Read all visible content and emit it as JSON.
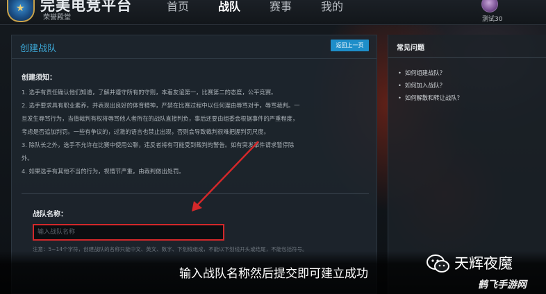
{
  "header": {
    "logo_title": "完美电竞平台",
    "logo_subtitle": "荣誉殿堂",
    "nav": [
      {
        "label": "首页",
        "active": false
      },
      {
        "label": "战队",
        "active": true
      },
      {
        "label": "赛事",
        "active": false
      },
      {
        "label": "我的",
        "active": false
      }
    ],
    "username": "测试30"
  },
  "main": {
    "title": "创建战队",
    "back_button": "返回上一页",
    "rules_heading": "创建须知：",
    "rules": [
      "1. 选手有责任确认他们知道，了解并遵守所有的守则，本着友谊第一，比赛第二的态度，公平竞赛。",
      "2. 选手要求具有职业素养，并表现出良好的体育精神，严禁在比赛过程中以任何理由辱骂对手，辱骂裁判。一",
      "旦发生辱骂行为，当值裁判有权将辱骂他人者所在的战队直接判负，事后还要由组委会根据事件的严重程度，",
      "考虑是否追加判罚。一些有争议的，过激的语言也禁止出现，否则会导致裁判很难把握判罚尺度。",
      "3. 除队长之外，选手不允许在比赛中使用公聊，违反者将有可能受到裁判的警告。如有突发事件请求暂停除",
      "外。",
      "4. 如果选手有其他不当的行为，视情节严重，由裁判做出处罚。"
    ],
    "name_label": "战队名称：",
    "name_input": {
      "value": "",
      "placeholder": "输入战队名称"
    },
    "note": "注意：5~14个字符，创建战队的名称只能中文、英文、数字、下划线组成，不能以下划线开头或结尾，不能包括符号。"
  },
  "faq": {
    "title": "常见问题",
    "items": [
      "如何组建战队？",
      "如何加入战队？",
      "如何解散和转让战队？"
    ]
  },
  "overlay": {
    "caption": "输入战队名称然后提交即可建立成功",
    "watermark_brand": "天辉夜魔",
    "watermark_site": "鹤飞手游网"
  },
  "colors": {
    "accent_blue": "#1e8ec9",
    "title_blue": "#3da9d8",
    "highlight_red": "#d3282a"
  }
}
